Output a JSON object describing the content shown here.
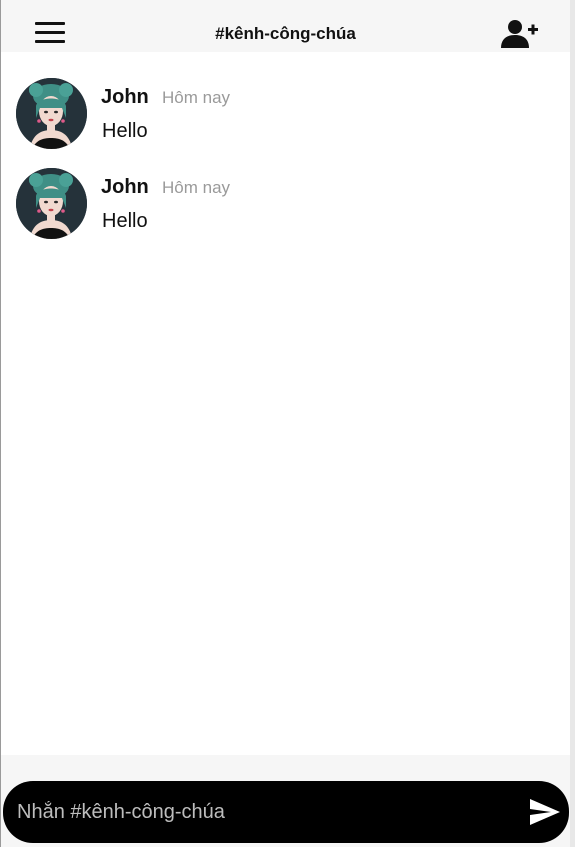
{
  "header": {
    "title": "#kênh-công-chúa",
    "menu_icon": "hamburger-menu-icon",
    "add_user_icon": "add-user-icon"
  },
  "messages": [
    {
      "author": "John",
      "time": "Hôm nay",
      "text": "Hello"
    },
    {
      "author": "John",
      "time": "Hôm nay",
      "text": "Hello"
    }
  ],
  "composer": {
    "placeholder": "Nhắn #kênh-công-chúa",
    "value": "",
    "send_icon": "send-icon"
  },
  "colors": {
    "composer_bg": "#000000",
    "timestamp": "#9a9a9a",
    "header_bg": "#f6f6f6"
  }
}
